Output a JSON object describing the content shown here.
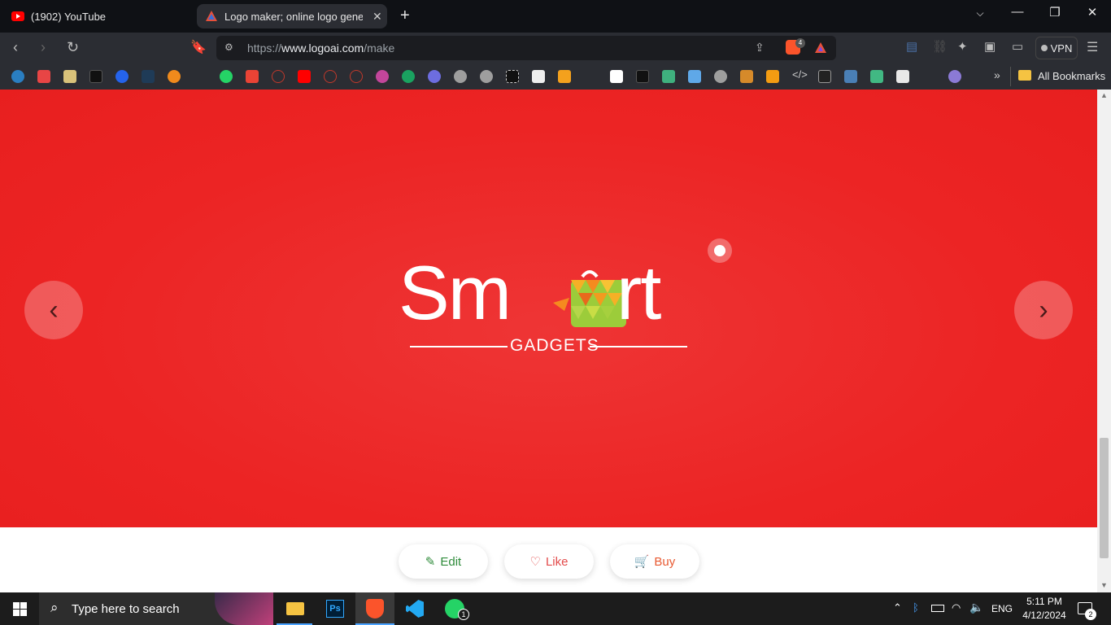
{
  "browser": {
    "tabs": [
      {
        "title": "(1902) YouTube",
        "active": false
      },
      {
        "title": "Logo maker; online logo genera",
        "active": true
      }
    ],
    "url_prefix": "https://",
    "url_domain": "www.logoai.com",
    "url_path": "/make",
    "vpn_label": "VPN",
    "shield_count": "4",
    "all_bookmarks_label": "All Bookmarks"
  },
  "logo": {
    "brand_text_left": "Sm",
    "brand_text_right": "rt",
    "tagline": "GADGETS",
    "colors": {
      "background": "#ec2424",
      "text": "#ffffff",
      "icon_orange": "#f58a1f",
      "icon_green": "#9ccc3a"
    }
  },
  "actions": [
    {
      "label": "Edit",
      "color": "#2e8b3a",
      "icon": "pencil-icon"
    },
    {
      "label": "Like",
      "color": "#e34b4b",
      "icon": "heart-icon"
    },
    {
      "label": "Buy",
      "color": "#e85a32",
      "icon": "cart-icon"
    }
  ],
  "taskbar": {
    "search_placeholder": "Type here to search",
    "language": "ENG",
    "time": "5:11 PM",
    "date": "4/12/2024",
    "notification_count": "2",
    "whatsapp_badge": "1"
  }
}
